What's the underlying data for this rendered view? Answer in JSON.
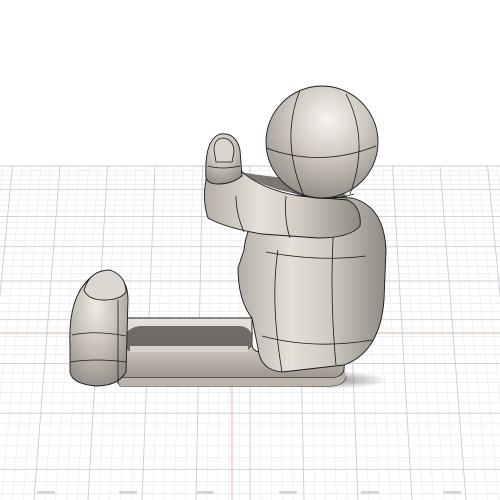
{
  "viewport": {
    "background": "#ffffff",
    "grid_major_color": "#c9cdd2",
    "grid_minor_color": "#e3e6ea",
    "x_axis_color": "#d98a8a",
    "y_axis_color": "#9ed19e",
    "model_base_color": "#c9c3ba",
    "model_shadow_color": "#8f8a84",
    "edge_color": "#1a1a1a"
  },
  "model": {
    "name_icon": "seated-figure-model"
  },
  "ground_ticks": [
    "",
    "",
    "",
    "",
    "",
    "",
    ""
  ]
}
